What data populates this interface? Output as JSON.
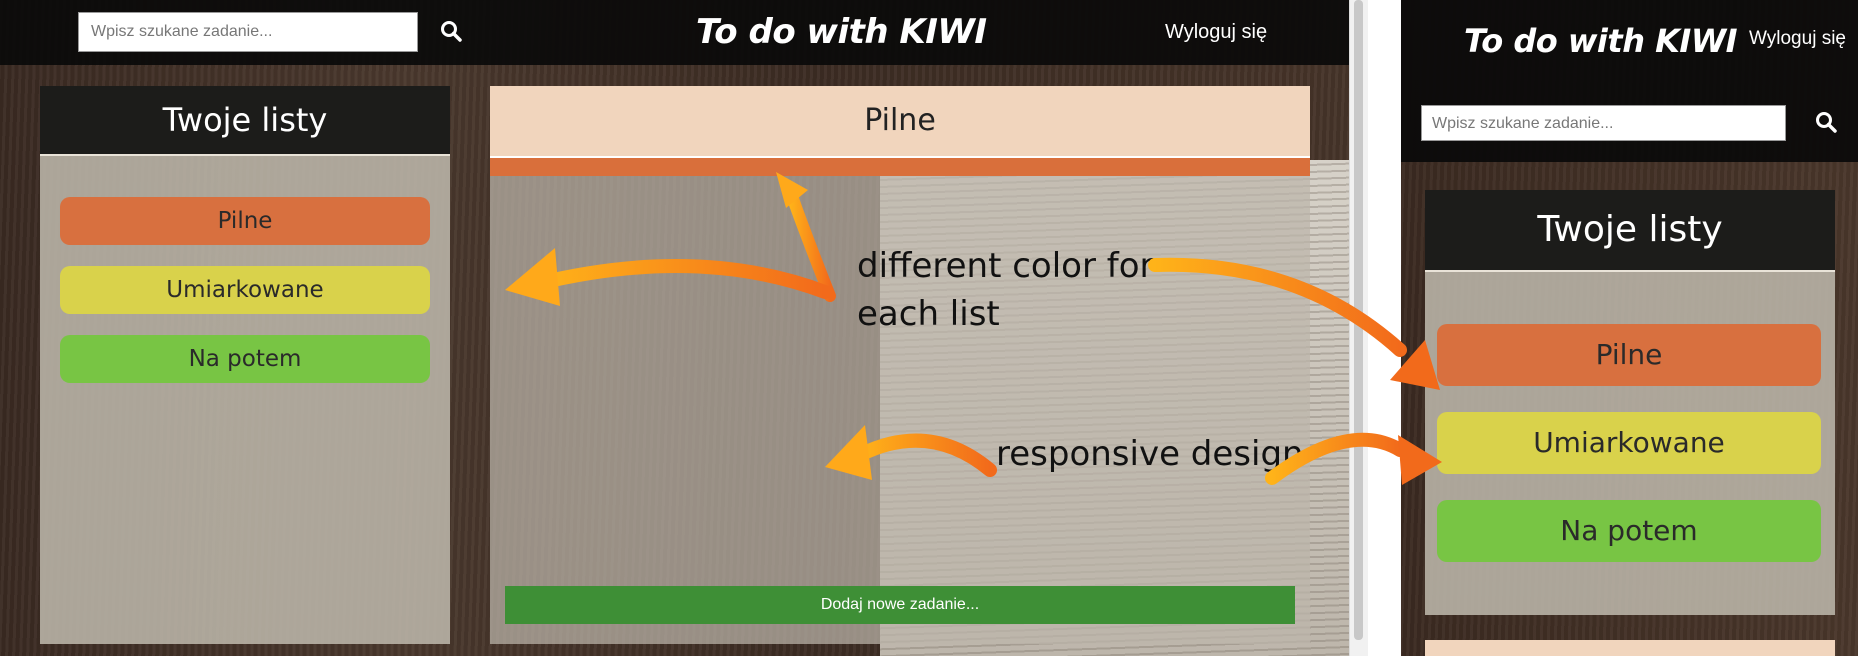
{
  "desktop": {
    "search_placeholder": "Wpisz szukane zadanie...",
    "brand": "To do with KIWI",
    "logout": "Wyloguj się",
    "lists_title": "Twoje listy",
    "lists": [
      {
        "label": "Pilne",
        "color": "#d8703f"
      },
      {
        "label": "Umiarkowane",
        "color": "#d9d24b"
      },
      {
        "label": "Na potem",
        "color": "#78c544"
      }
    ],
    "main_title": "Pilne",
    "add_task": "Dodaj nowe zadanie..."
  },
  "annotations": {
    "color_note_line1": "different color for",
    "color_note_line2": "each list",
    "responsive_note": "responsive design"
  },
  "mobile": {
    "brand": "To do with KIWI",
    "logout": "Wyloguj się",
    "search_placeholder": "Wpisz szukane zadanie...",
    "lists_title": "Twoje listy",
    "lists": [
      {
        "label": "Pilne",
        "color": "#d8703f"
      },
      {
        "label": "Umiarkowane",
        "color": "#d9d24b"
      },
      {
        "label": "Na potem",
        "color": "#78c544"
      }
    ]
  },
  "icons": [
    "search-icon",
    "arrow-icon"
  ],
  "colors": {
    "accent_orange": "#d96f3b",
    "add_green": "#3e8f36",
    "header_peach": "#f1d5bd"
  }
}
